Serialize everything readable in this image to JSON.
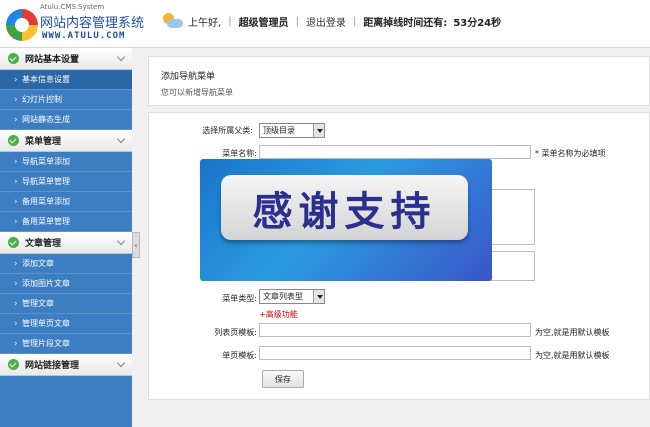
{
  "header": {
    "logo_small": "Atulu.CMS.System",
    "logo_title": "网站内容管理系统",
    "logo_url": "WWW.ATULU.COM",
    "greeting": "上午好,",
    "role": "超级管理员",
    "logout": "退出登录",
    "timeout_label": "距离掉线时间还有:",
    "timeout_value": "53分24秒"
  },
  "sidebar": {
    "groups": [
      {
        "title": "网站基本设置",
        "items": [
          "基本信息设置",
          "幻灯片控制",
          "网站静态生成"
        ]
      },
      {
        "title": "菜单管理",
        "items": [
          "导航菜单添加",
          "导航菜单管理",
          "备用菜单添加",
          "备用菜单管理"
        ]
      },
      {
        "title": "文章管理",
        "items": [
          "添加文章",
          "添加图片文章",
          "管理文章",
          "管理单页文章",
          "管理片段文章"
        ]
      },
      {
        "title": "网站链接管理",
        "items": []
      }
    ],
    "collapse_glyph": "‹"
  },
  "page": {
    "title": "添加导航菜单",
    "subtitle": "您可以新增导航菜单"
  },
  "form": {
    "parent_label": "选择所属父类:",
    "parent_value": "顶级目录",
    "name_label": "菜单名称:",
    "name_hint": "* 菜单名称为必填项",
    "type_label": "菜单类型:",
    "type_value": "文章列表型",
    "advanced": "+高级功能",
    "list_tpl_label": "列表页模板:",
    "list_tpl_hint": "为空,就是用默认模板",
    "single_tpl_label": "单页模板:",
    "single_tpl_hint": "为空,就是用默认模板",
    "save": "保存"
  },
  "watermark": {
    "text": "感谢支持"
  },
  "colors": {
    "sidebar": "#3c7ec1",
    "active": "#2b67a6",
    "check": "#4cae4c",
    "advanced": "#cc0000"
  }
}
